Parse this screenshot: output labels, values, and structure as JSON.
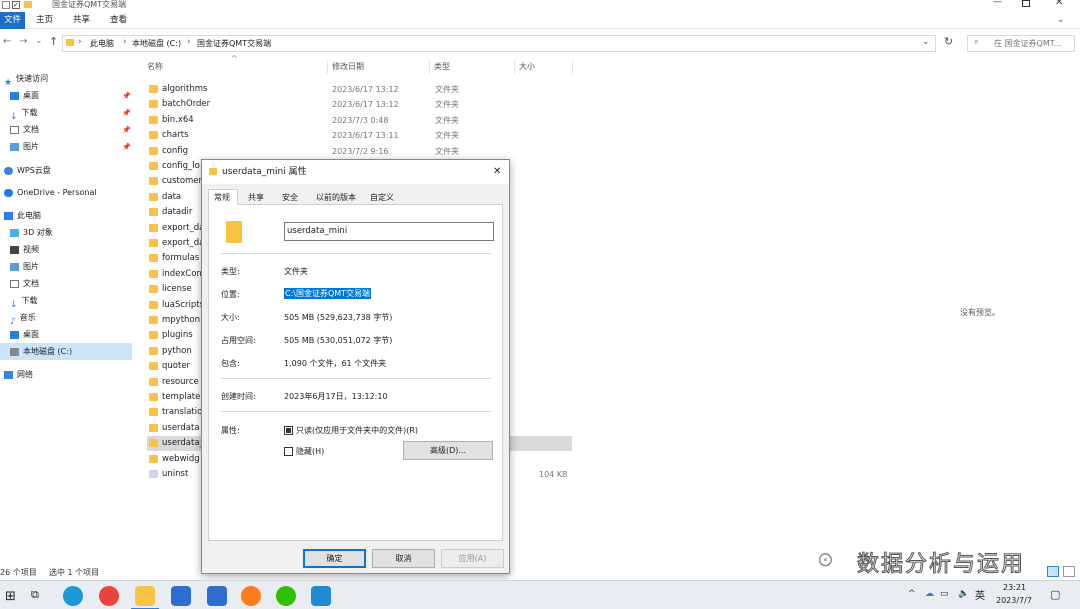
{
  "window": {
    "title": "国金证券QMT交易端"
  },
  "ribbon": {
    "tabs": [
      "文件",
      "主页",
      "共享",
      "查看"
    ]
  },
  "address": {
    "crumbs": [
      "此电脑",
      "本地磁盘 (C:)",
      "国金证券QMT交易端"
    ],
    "search_placeholder": "在 国金证券QMT..."
  },
  "nav": {
    "items": [
      {
        "label": "快速访问"
      },
      {
        "label": "桌面"
      },
      {
        "label": "下载"
      },
      {
        "label": "文档"
      },
      {
        "label": "图片"
      },
      {
        "label": "WPS云盘"
      },
      {
        "label": "OneDrive - Personal"
      },
      {
        "label": "此电脑"
      },
      {
        "label": "3D 对象"
      },
      {
        "label": "视频"
      },
      {
        "label": "图片"
      },
      {
        "label": "文档"
      },
      {
        "label": "下载"
      },
      {
        "label": "音乐"
      },
      {
        "label": "桌面"
      },
      {
        "label": "本地磁盘 (C:)"
      },
      {
        "label": "网络"
      }
    ]
  },
  "columns": {
    "name": "名称",
    "date": "修改日期",
    "type": "类型",
    "size": "大小"
  },
  "files": [
    {
      "name": "algorithms",
      "date": "2023/6/17 13:12",
      "type": "文件夹",
      "size": ""
    },
    {
      "name": "batchOrder",
      "date": "2023/6/17 13:12",
      "type": "文件夹",
      "size": ""
    },
    {
      "name": "bin.x64",
      "date": "2023/7/3 0:48",
      "type": "文件夹",
      "size": ""
    },
    {
      "name": "charts",
      "date": "2023/6/17 13:11",
      "type": "文件夹",
      "size": ""
    },
    {
      "name": "config",
      "date": "2023/7/2 9:16",
      "type": "文件夹",
      "size": ""
    },
    {
      "name": "config_lo",
      "date": "",
      "type": "",
      "size": ""
    },
    {
      "name": "customer",
      "date": "",
      "type": "",
      "size": ""
    },
    {
      "name": "data",
      "date": "",
      "type": "",
      "size": ""
    },
    {
      "name": "datadir",
      "date": "",
      "type": "",
      "size": ""
    },
    {
      "name": "export_da",
      "date": "",
      "type": "",
      "size": ""
    },
    {
      "name": "export_da",
      "date": "",
      "type": "",
      "size": ""
    },
    {
      "name": "formulas",
      "date": "",
      "type": "",
      "size": ""
    },
    {
      "name": "indexCon",
      "date": "",
      "type": "",
      "size": ""
    },
    {
      "name": "license",
      "date": "",
      "type": "",
      "size": ""
    },
    {
      "name": "luaScripts",
      "date": "",
      "type": "",
      "size": ""
    },
    {
      "name": "mpython",
      "date": "",
      "type": "",
      "size": ""
    },
    {
      "name": "plugins",
      "date": "",
      "type": "",
      "size": ""
    },
    {
      "name": "python",
      "date": "",
      "type": "",
      "size": ""
    },
    {
      "name": "quoter",
      "date": "",
      "type": "",
      "size": ""
    },
    {
      "name": "resource",
      "date": "",
      "type": "",
      "size": ""
    },
    {
      "name": "template",
      "date": "",
      "type": "",
      "size": ""
    },
    {
      "name": "translatio",
      "date": "",
      "type": "",
      "size": ""
    },
    {
      "name": "userdata",
      "date": "",
      "type": "",
      "size": ""
    },
    {
      "name": "userdata_",
      "date": "",
      "type": "",
      "size": ""
    },
    {
      "name": "webwidg",
      "date": "",
      "type": "",
      "size": ""
    },
    {
      "name": "uninst",
      "date": "",
      "type": "",
      "size": "104 KB"
    }
  ],
  "preview": {
    "text": "没有预览。"
  },
  "status": {
    "count": "26 个项目",
    "selected": "选中 1 个项目"
  },
  "dialog": {
    "title": "userdata_mini 属性",
    "tabs": [
      "常规",
      "共享",
      "安全",
      "以前的版本",
      "自定义"
    ],
    "name_value": "userdata_mini",
    "props": [
      {
        "label": "类型:",
        "value": "文件夹"
      },
      {
        "label": "位置:",
        "value": "C:\\国金证券QMT交易端"
      },
      {
        "label": "大小:",
        "value": "505 MB (529,623,738 字节)"
      },
      {
        "label": "占用空间:",
        "value": "505 MB (530,051,072 字节)"
      },
      {
        "label": "包含:",
        "value": "1,090 个文件，61 个文件夹"
      }
    ],
    "created_label": "创建时间:",
    "created_value": "2023年6月17日，13:12:10",
    "attr_label": "属性:",
    "readonly_label": "只读(仅应用于文件夹中的文件)(R)",
    "hidden_label": "隐藏(H)",
    "advanced_button": "高级(D)...",
    "ok": "确定",
    "cancel": "取消",
    "apply": "应用(A)"
  },
  "watermark": {
    "text": "数据分析与运用"
  },
  "taskbar": {
    "ime": "英",
    "time": "23:21",
    "date": "2023/7/7"
  }
}
